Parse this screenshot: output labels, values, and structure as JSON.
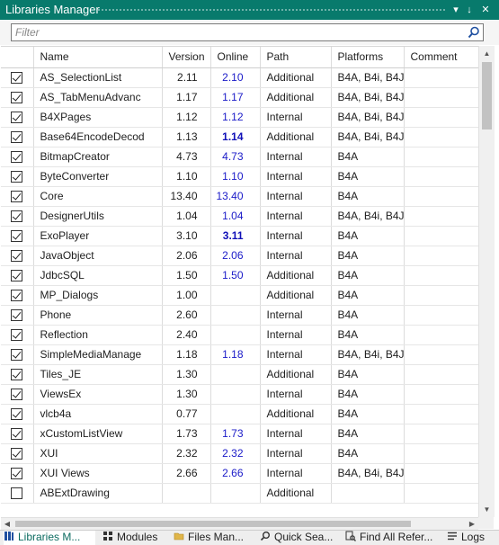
{
  "window": {
    "title": "Libraries Manager",
    "pin_glyph": "↓",
    "pin_icon": "pin-icon",
    "close_glyph": "✕"
  },
  "filter": {
    "placeholder": "Filter",
    "value": ""
  },
  "columns": [
    "Name",
    "Version",
    "Online",
    "Path",
    "Platforms",
    "Comment"
  ],
  "rows": [
    {
      "checked": true,
      "name": "AS_SelectionList",
      "version": "2.11",
      "online": "2.10",
      "online_bold": false,
      "path": "Additional",
      "platforms": "B4A, B4i, B4J",
      "comment": ""
    },
    {
      "checked": true,
      "name": "AS_TabMenuAdvanc",
      "version": "1.17",
      "online": "1.17",
      "online_bold": false,
      "path": "Additional",
      "platforms": "B4A, B4i, B4J",
      "comment": ""
    },
    {
      "checked": true,
      "name": "B4XPages",
      "version": "1.12",
      "online": "1.12",
      "online_bold": false,
      "path": "Internal",
      "platforms": "B4A, B4i, B4J",
      "comment": ""
    },
    {
      "checked": true,
      "name": "Base64EncodeDecod",
      "version": "1.13",
      "online": "1.14",
      "online_bold": true,
      "path": "Additional",
      "platforms": "B4A, B4i, B4J",
      "comment": ""
    },
    {
      "checked": true,
      "name": "BitmapCreator",
      "version": "4.73",
      "online": "4.73",
      "online_bold": false,
      "path": "Internal",
      "platforms": "B4A",
      "comment": ""
    },
    {
      "checked": true,
      "name": "ByteConverter",
      "version": "1.10",
      "online": "1.10",
      "online_bold": false,
      "path": "Internal",
      "platforms": "B4A",
      "comment": ""
    },
    {
      "checked": true,
      "name": "Core",
      "version": "13.40",
      "online": "13.40",
      "online_bold": false,
      "path": "Internal",
      "platforms": "B4A",
      "comment": ""
    },
    {
      "checked": true,
      "name": "DesignerUtils",
      "version": "1.04",
      "online": "1.04",
      "online_bold": false,
      "path": "Internal",
      "platforms": "B4A, B4i, B4J",
      "comment": ""
    },
    {
      "checked": true,
      "name": "ExoPlayer",
      "version": "3.10",
      "online": "3.11",
      "online_bold": true,
      "path": "Internal",
      "platforms": "B4A",
      "comment": ""
    },
    {
      "checked": true,
      "name": "JavaObject",
      "version": "2.06",
      "online": "2.06",
      "online_bold": false,
      "path": "Internal",
      "platforms": "B4A",
      "comment": ""
    },
    {
      "checked": true,
      "name": "JdbcSQL",
      "version": "1.50",
      "online": "1.50",
      "online_bold": false,
      "path": "Additional",
      "platforms": "B4A",
      "comment": ""
    },
    {
      "checked": true,
      "name": "MP_Dialogs",
      "version": "1.00",
      "online": "",
      "online_bold": false,
      "path": "Additional",
      "platforms": "B4A",
      "comment": ""
    },
    {
      "checked": true,
      "name": "Phone",
      "version": "2.60",
      "online": "",
      "online_bold": false,
      "path": "Internal",
      "platforms": "B4A",
      "comment": ""
    },
    {
      "checked": true,
      "name": "Reflection",
      "version": "2.40",
      "online": "",
      "online_bold": false,
      "path": "Internal",
      "platforms": "B4A",
      "comment": ""
    },
    {
      "checked": true,
      "name": "SimpleMediaManage",
      "version": "1.18",
      "online": "1.18",
      "online_bold": false,
      "path": "Internal",
      "platforms": "B4A, B4i, B4J",
      "comment": ""
    },
    {
      "checked": true,
      "name": "Tiles_JE",
      "version": "1.30",
      "online": "",
      "online_bold": false,
      "path": "Additional",
      "platforms": "B4A",
      "comment": ""
    },
    {
      "checked": true,
      "name": "ViewsEx",
      "version": "1.30",
      "online": "",
      "online_bold": false,
      "path": "Internal",
      "platforms": "B4A",
      "comment": ""
    },
    {
      "checked": true,
      "name": "vlcb4a",
      "version": "0.77",
      "online": "",
      "online_bold": false,
      "path": "Additional",
      "platforms": "B4A",
      "comment": ""
    },
    {
      "checked": true,
      "name": "xCustomListView",
      "version": "1.73",
      "online": "1.73",
      "online_bold": false,
      "path": "Internal",
      "platforms": "B4A",
      "comment": ""
    },
    {
      "checked": true,
      "name": "XUI",
      "version": "2.32",
      "online": "2.32",
      "online_bold": false,
      "path": "Internal",
      "platforms": "B4A",
      "comment": ""
    },
    {
      "checked": true,
      "name": "XUI Views",
      "version": "2.66",
      "online": "2.66",
      "online_bold": false,
      "path": "Internal",
      "platforms": "B4A, B4i, B4J",
      "comment": ""
    },
    {
      "checked": false,
      "name": "ABExtDrawing",
      "version": "",
      "online": "",
      "online_bold": false,
      "path": "Additional",
      "platforms": "",
      "comment": ""
    }
  ],
  "tabs": [
    {
      "label": "Libraries M...",
      "icon": "libraries-icon",
      "active": true
    },
    {
      "label": "Modules",
      "icon": "modules-icon",
      "active": false
    },
    {
      "label": "Files Man...",
      "icon": "folder-icon",
      "active": false
    },
    {
      "label": "Quick Sea...",
      "icon": "search-icon",
      "active": false
    },
    {
      "label": "Find All Refer...",
      "icon": "find-references-icon",
      "active": false
    },
    {
      "label": "Logs",
      "icon": "logs-icon",
      "active": false
    }
  ],
  "colors": {
    "accent": "#087a6c",
    "online_version": "#1a1ac8",
    "active_tab_text": "#0b6b60"
  }
}
